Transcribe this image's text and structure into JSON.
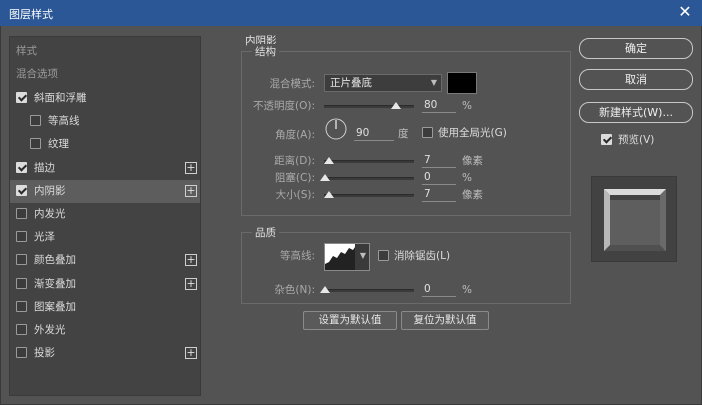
{
  "window": {
    "title": "图层样式",
    "close": "✕"
  },
  "styles_list": {
    "header": "样式",
    "blend_options": "混合选项",
    "items": [
      {
        "label": "斜面和浮雕",
        "checked": true,
        "plus": false,
        "indent": false,
        "selected": false
      },
      {
        "label": "等高线",
        "checked": false,
        "plus": false,
        "indent": true,
        "selected": false
      },
      {
        "label": "纹理",
        "checked": false,
        "plus": false,
        "indent": true,
        "selected": false
      },
      {
        "label": "描边",
        "checked": true,
        "plus": true,
        "indent": false,
        "selected": false
      },
      {
        "label": "内阴影",
        "checked": true,
        "plus": true,
        "indent": false,
        "selected": true
      },
      {
        "label": "内发光",
        "checked": false,
        "plus": false,
        "indent": false,
        "selected": false
      },
      {
        "label": "光泽",
        "checked": false,
        "plus": false,
        "indent": false,
        "selected": false
      },
      {
        "label": "颜色叠加",
        "checked": false,
        "plus": true,
        "indent": false,
        "selected": false
      },
      {
        "label": "渐变叠加",
        "checked": false,
        "plus": true,
        "indent": false,
        "selected": false
      },
      {
        "label": "图案叠加",
        "checked": false,
        "plus": false,
        "indent": false,
        "selected": false
      },
      {
        "label": "外发光",
        "checked": false,
        "plus": false,
        "indent": false,
        "selected": false
      },
      {
        "label": "投影",
        "checked": false,
        "plus": true,
        "indent": false,
        "selected": false
      }
    ]
  },
  "inner_shadow": {
    "title": "内阴影",
    "structure": {
      "legend": "结构",
      "blend_mode_label": "混合模式:",
      "blend_mode_value": "正片叠底",
      "shadow_color": "#000000",
      "opacity_label": "不透明度(O):",
      "opacity_value": "80",
      "opacity_fraction": 0.8,
      "opacity_unit": "%",
      "angle_label": "角度(A):",
      "angle_value": "90",
      "angle_unit": "度",
      "global_light_label": "使用全局光(G)",
      "global_light_checked": false,
      "distance_label": "距离(D):",
      "distance_value": "7",
      "distance_unit": "像素",
      "choke_label": "阻塞(C):",
      "choke_value": "0",
      "choke_unit": "%",
      "size_label": "大小(S):",
      "size_value": "7",
      "size_unit": "像素"
    },
    "quality": {
      "legend": "品质",
      "contour_label": "等高线:",
      "anti_alias_label": "消除锯齿(L)",
      "anti_alias_checked": false,
      "noise_label": "杂色(N):",
      "noise_value": "0",
      "noise_unit": "%"
    },
    "make_default": "设置为默认值",
    "reset_default": "复位为默认值"
  },
  "actions": {
    "ok": "确定",
    "cancel": "取消",
    "new_style": "新建样式(W)...",
    "preview_label": "预览(V)",
    "preview_checked": true
  }
}
